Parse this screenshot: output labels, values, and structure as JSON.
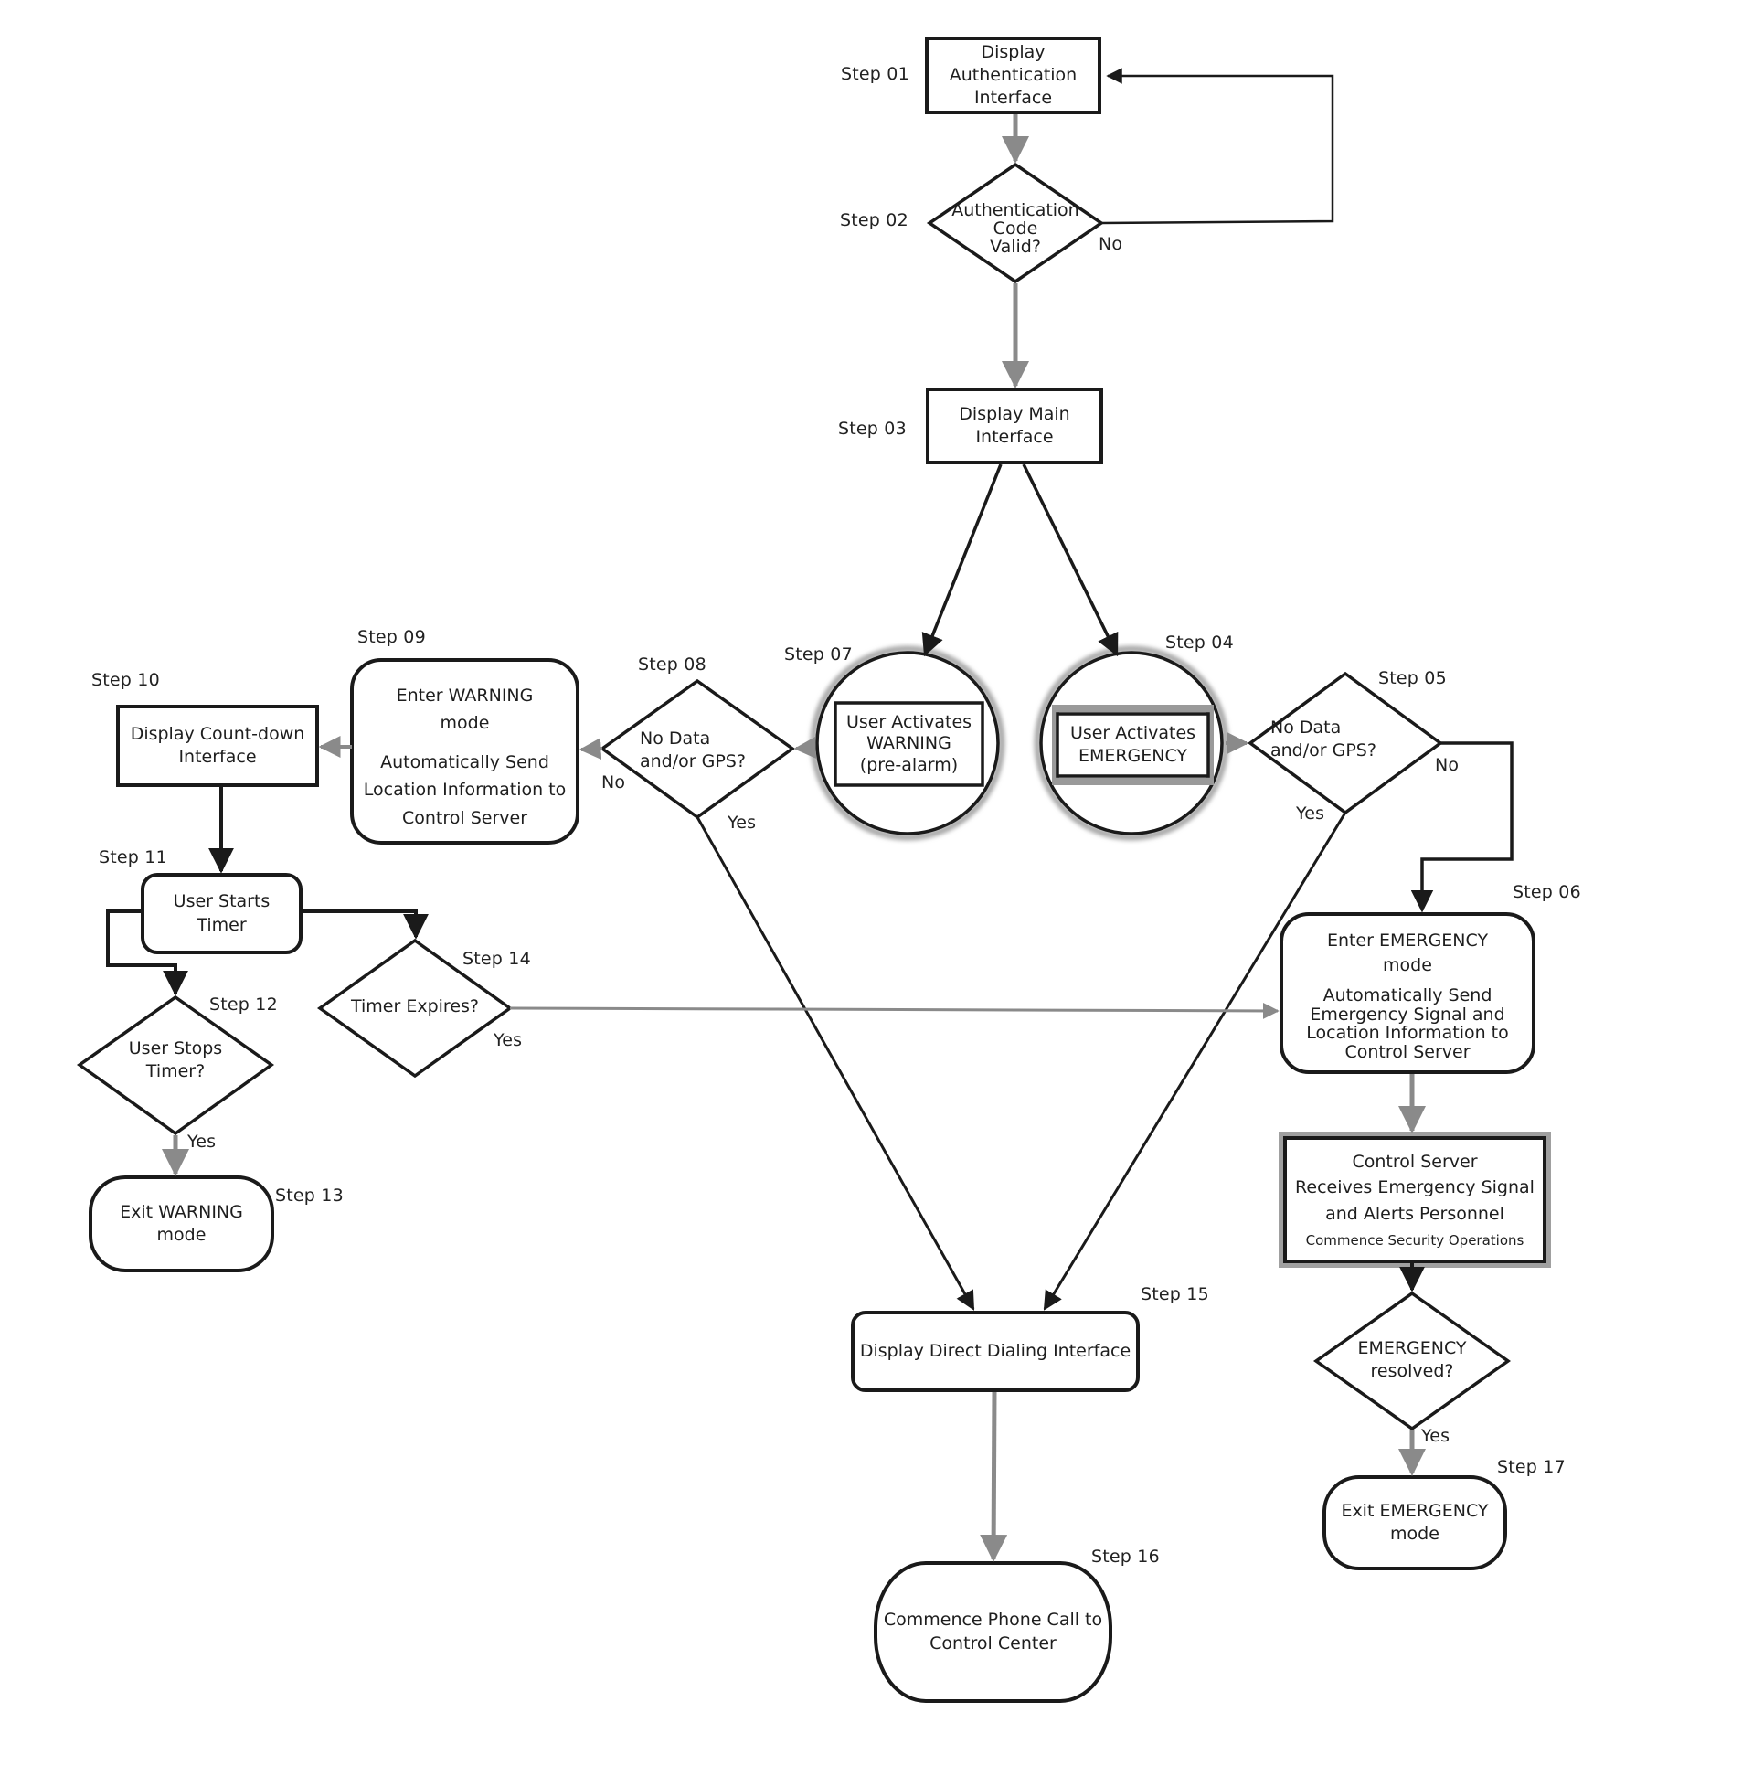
{
  "diagram": {
    "steps": {
      "s01": {
        "label": "Step 01",
        "lines": [
          "Display",
          "Authentication",
          "Interface"
        ]
      },
      "s02": {
        "label": "Step 02",
        "lines": [
          "Authentication",
          "Code",
          "Valid?"
        ],
        "no_label": "No"
      },
      "s03": {
        "label": "Step 03",
        "lines": [
          "Display Main",
          "Interface"
        ]
      },
      "s04": {
        "label": "Step 04",
        "lines": [
          "User Activates",
          "EMERGENCY"
        ]
      },
      "s05": {
        "label": "Step 05",
        "lines": [
          "No Data",
          "and/or GPS?"
        ],
        "yes_label": "Yes",
        "no_label": "No"
      },
      "s06": {
        "label": "Step 06",
        "lines": [
          "Enter EMERGENCY",
          "mode"
        ],
        "sublines": [
          "Automatically Send",
          "Emergency Signal and",
          "Location Information to",
          "Control Server"
        ]
      },
      "s06b": {
        "lines": [
          "Control Server",
          "Receives Emergency Signal",
          "and Alerts Personnel"
        ],
        "subline": "Commence Security Operations"
      },
      "s06c": {
        "lines": [
          "EMERGENCY",
          "resolved?"
        ],
        "yes_label": "Yes"
      },
      "s07": {
        "label": "Step 07",
        "lines": [
          "User Activates",
          "WARNING",
          "(pre-alarm)"
        ]
      },
      "s08": {
        "label": "Step 08",
        "lines": [
          "No Data",
          "and/or GPS?"
        ],
        "yes_label": "Yes",
        "no_label": "No"
      },
      "s09": {
        "label": "Step 09",
        "lines": [
          "Enter WARNING",
          "mode"
        ],
        "sublines": [
          "Automatically Send",
          "Location Information to",
          "Control  Server"
        ]
      },
      "s10": {
        "label": "Step 10",
        "lines": [
          "Display Count-down",
          "Interface"
        ]
      },
      "s11": {
        "label": "Step 11",
        "lines": [
          "User Starts",
          "Timer"
        ]
      },
      "s12": {
        "label": "Step 12",
        "lines": [
          "User Stops",
          "Timer?"
        ],
        "yes_label": "Yes"
      },
      "s13": {
        "label": "Step 13",
        "lines": [
          "Exit WARNING",
          "mode"
        ]
      },
      "s14": {
        "label": "Step 14",
        "lines": [
          "Timer Expires?"
        ],
        "yes_label": "Yes"
      },
      "s15": {
        "label": "Step 15",
        "lines": [
          "Display Direct Dialing Interface"
        ]
      },
      "s16": {
        "label": "Step 16",
        "lines": [
          "Commence Phone Call to",
          "Control Center"
        ]
      },
      "s17": {
        "label": "Step 17",
        "lines": [
          "Exit EMERGENCY",
          "mode"
        ]
      }
    },
    "colors": {
      "stroke": "#1a1a1a",
      "gray_arrow": "#8a8a8a",
      "halo": "#9c9c9c",
      "background": "#ffffff"
    }
  }
}
